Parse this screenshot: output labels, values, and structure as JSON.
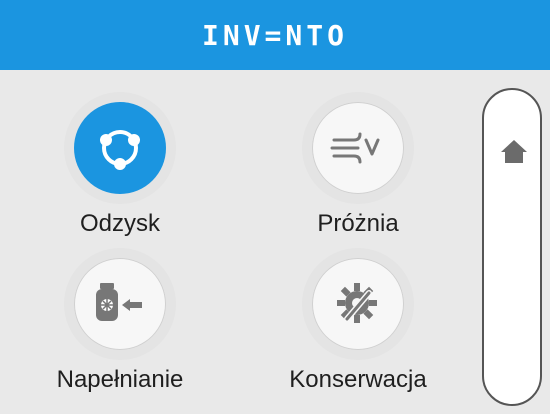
{
  "header": {
    "logo_text": "INV=NTO"
  },
  "menu": {
    "items": [
      {
        "label": "Odzysk",
        "icon": "recovery-icon",
        "active": true
      },
      {
        "label": "Próżnia",
        "icon": "vacuum-icon",
        "active": false
      },
      {
        "label": "Napełnianie",
        "icon": "filling-icon",
        "active": false
      },
      {
        "label": "Konserwacja",
        "icon": "maintenance-icon",
        "active": false
      }
    ]
  },
  "sidebar": {
    "home_icon": "home-icon"
  },
  "colors": {
    "accent": "#1b95e0",
    "background": "#e9e9e9"
  }
}
